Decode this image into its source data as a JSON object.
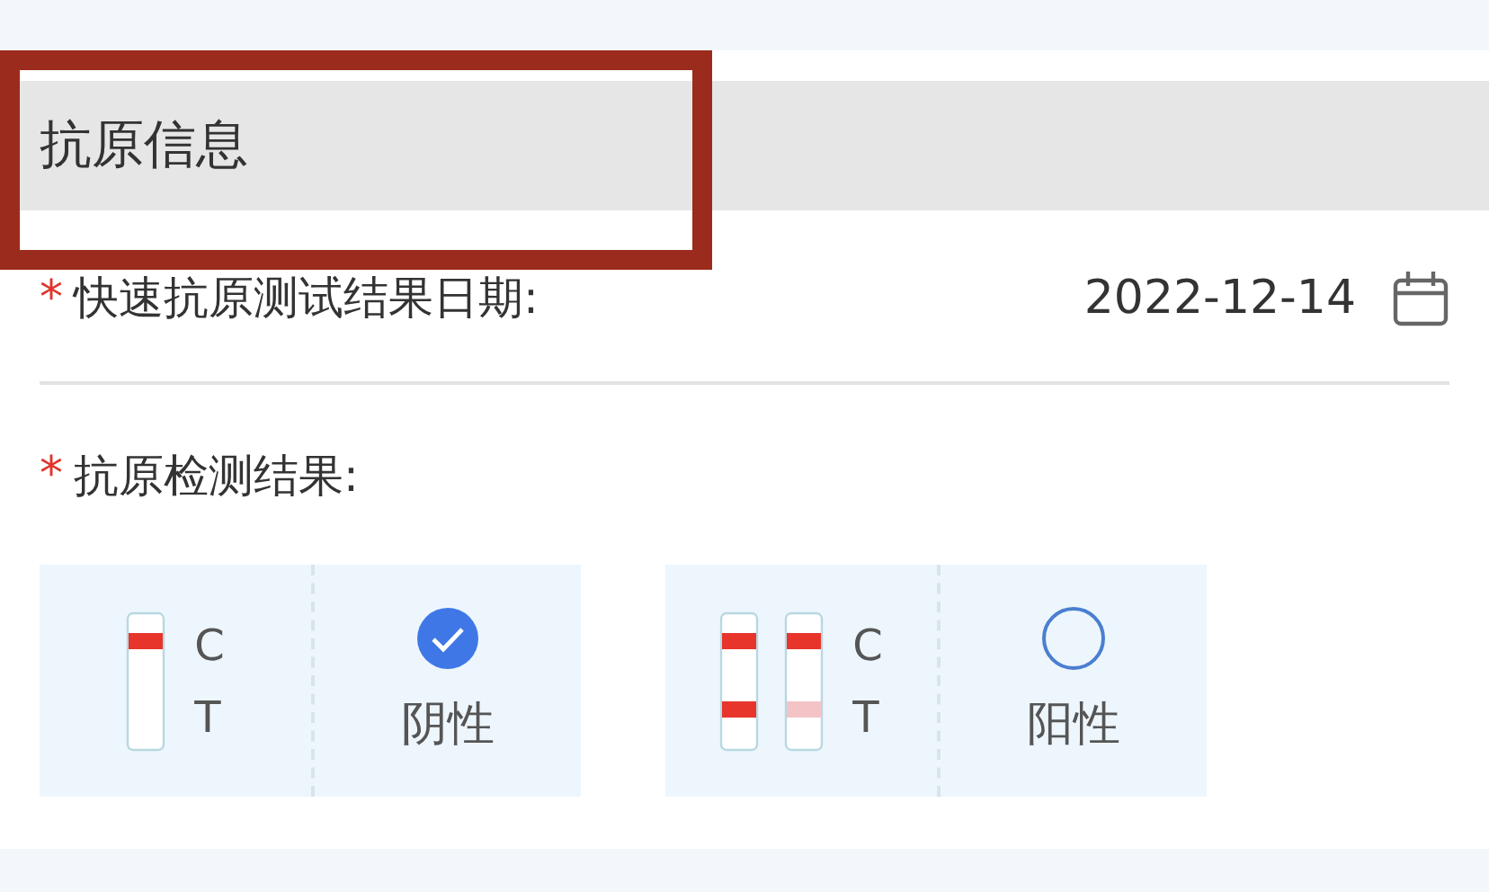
{
  "section": {
    "title": "抗原信息"
  },
  "date_field": {
    "required_mark": "*",
    "label": "快速抗原测试结果日期:",
    "value": "2022-12-14"
  },
  "result_field": {
    "required_mark": "*",
    "label": "抗原检测结果:"
  },
  "options": [
    {
      "label": "阴性",
      "selected": true,
      "c_label": "C",
      "t_label": "T",
      "strips": [
        {
          "kind": "negative",
          "c_band": true
        }
      ]
    },
    {
      "label": "阳性",
      "selected": false,
      "c_label": "C",
      "t_label": "T",
      "strips": [
        {
          "kind": "positive",
          "c_band": true
        },
        {
          "kind": "weak",
          "c_band": true
        }
      ]
    }
  ]
}
